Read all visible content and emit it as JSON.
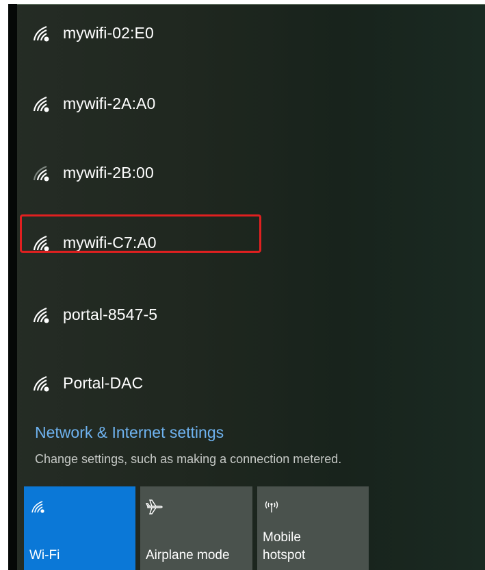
{
  "networks": [
    {
      "name": "mywifi-02:E0",
      "icon": "wifi-strong-icon"
    },
    {
      "name": "mywifi-2A:A0",
      "icon": "wifi-strong-icon"
    },
    {
      "name": "mywifi-2B:00",
      "icon": "wifi-medium-icon"
    },
    {
      "name": "mywifi-C7:A0",
      "icon": "wifi-strong-icon"
    },
    {
      "name": "portal-8547-5",
      "icon": "wifi-strong-icon"
    },
    {
      "name": "Portal-DAC",
      "icon": "wifi-strong-icon"
    }
  ],
  "settings": {
    "link": "Network & Internet settings",
    "description": "Change settings, such as making a connection metered."
  },
  "quick_actions": [
    {
      "label": "Wi-Fi",
      "icon": "wifi-icon",
      "active": true
    },
    {
      "label": "Airplane mode",
      "icon": "airplane-icon",
      "active": false
    },
    {
      "label_line1": "Mobile",
      "label_line2": "hotspot",
      "icon": "mobile-hotspot-icon",
      "active": false
    }
  ],
  "colors": {
    "accent": "#0b78d7",
    "link": "#6fb3f0",
    "highlight": "#e02020",
    "tile_inactive": "#4a524d"
  }
}
